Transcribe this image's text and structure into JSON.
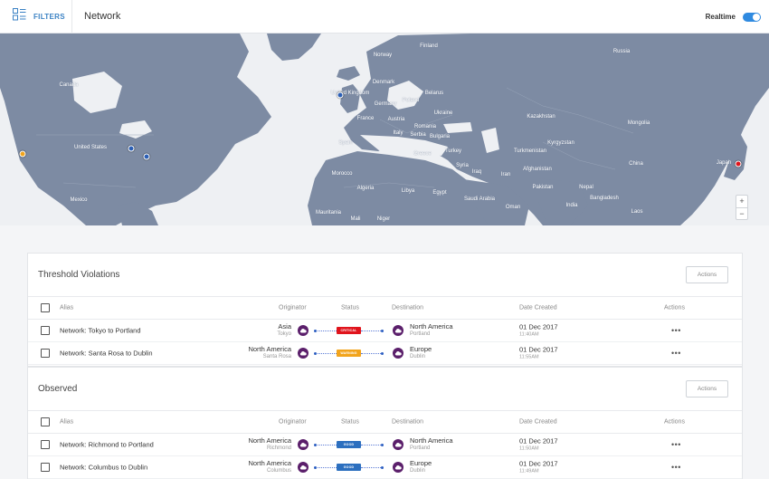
{
  "header": {
    "filters_label": "FILTERS",
    "title": "Network",
    "realtime_label": "Realtime",
    "realtime_on": true
  },
  "map": {
    "labels": [
      "Canada",
      "United States",
      "Mexico",
      "Finland",
      "Norway",
      "Russia",
      "Denmark",
      "United Kingdom",
      "Poland",
      "Belarus",
      "Germany",
      "Ukraine",
      "France",
      "Austria",
      "Romania",
      "Spain",
      "Italy",
      "Serbia",
      "Bulgaria",
      "Greece",
      "Turkey",
      "Kazakhstan",
      "Mongolia",
      "Kyrgyzstan",
      "Turkmenistan",
      "Syria",
      "Iraq",
      "Iran",
      "Afghanistan",
      "Pakistan",
      "China",
      "Japan",
      "Nepal",
      "Bangladesh",
      "India",
      "Morocco",
      "Algeria",
      "Libya",
      "Egypt",
      "Saudi Arabia",
      "Oman",
      "Mauritania",
      "Mali",
      "Niger",
      "Laos"
    ],
    "zoom_in": "+",
    "zoom_out": "−",
    "colors": {
      "land": "#7d8ba3",
      "water": "#eef0f3"
    }
  },
  "columns": {
    "alias": "Alias",
    "originator": "Originator",
    "status": "Status",
    "destination": "Destination",
    "date": "Date Created",
    "actions": "Actions"
  },
  "threshold": {
    "title": "Threshold Violations",
    "actions_label": "Actions",
    "rows": [
      {
        "alias": "Network: Tokyo to Portland",
        "origin": "Asia",
        "origin_sub": "Tokyo",
        "status": "CRITICAL",
        "status_color": "#e0141c",
        "dest": "North America",
        "dest_sub": "Portland",
        "date": "01 Dec 2017",
        "time": "11:40AM",
        "more": "•••"
      },
      {
        "alias": "Network: Santa Rosa to Dublin",
        "origin": "North America",
        "origin_sub": "Santa Rosa",
        "status": "WARNING",
        "status_color": "#f2a41c",
        "dest": "Europe",
        "dest_sub": "Dublin",
        "date": "01 Dec 2017",
        "time": "11:55AM",
        "more": "•••"
      }
    ]
  },
  "observed": {
    "title": "Observed",
    "actions_label": "Actions",
    "rows": [
      {
        "alias": "Network: Richmond to Portland",
        "origin": "North America",
        "origin_sub": "Richmond",
        "status": "GOOD",
        "status_color": "#2c6fbf",
        "dest": "North America",
        "dest_sub": "Portland",
        "date": "01 Dec 2017",
        "time": "11:50AM",
        "more": "•••"
      },
      {
        "alias": "Network: Columbus to Dublin",
        "origin": "North America",
        "origin_sub": "Columbus",
        "status": "GOOD",
        "status_color": "#2c6fbf",
        "dest": "Europe",
        "dest_sub": "Dublin",
        "date": "01 Dec 2017",
        "time": "11:49AM",
        "more": "•••"
      }
    ]
  }
}
